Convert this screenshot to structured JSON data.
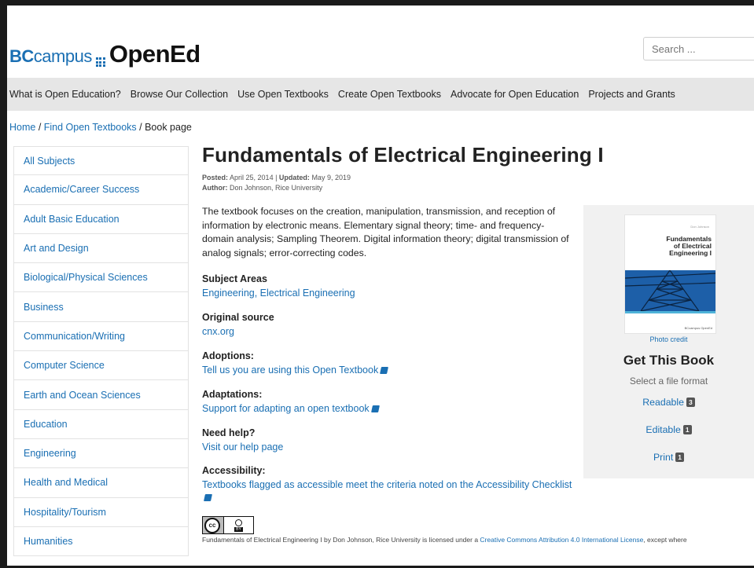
{
  "header": {
    "logo_bc": "BC",
    "logo_campus": "campus",
    "logo_opened": "OpenEd",
    "search_placeholder": "Search ..."
  },
  "nav": {
    "items": [
      "What is Open Education?",
      "Browse Our Collection",
      "Use Open Textbooks",
      "Create Open Textbooks",
      "Advocate for Open Education",
      "Projects and Grants"
    ]
  },
  "breadcrumb": {
    "home": "Home",
    "sep1": " / ",
    "find": "Find Open Textbooks",
    "sep2": " / ",
    "current": "Book page"
  },
  "sidebar": {
    "items": [
      "All Subjects",
      "Academic/Career Success",
      "Adult Basic Education",
      "Art and Design",
      "Biological/Physical Sciences",
      "Business",
      "Communication/Writing",
      "Computer Science",
      "Earth and Ocean Sciences",
      "Education",
      "Engineering",
      "Health and Medical",
      "Hospitality/Tourism",
      "Humanities"
    ]
  },
  "book": {
    "title": "Fundamentals of Electrical Engineering I",
    "posted_label": "Posted:",
    "posted": "April 25, 2014",
    "meta_sep": " | ",
    "updated_label": "Updated:",
    "updated": "May 9, 2019",
    "author_label": "Author:",
    "author": "Don Johnson, Rice University",
    "description": "The textbook focuses on the creation, manipulation, transmission, and reception of information by electronic means. Elementary signal theory; time- and frequency-domain analysis; Sampling Theorem. Digital information theory; digital transmission of analog signals; error-correcting codes."
  },
  "sections": {
    "subject_areas": {
      "heading": "Subject Areas",
      "value": "Engineering, Electrical Engineering"
    },
    "original_source": {
      "heading": "Original source",
      "value": "cnx.org"
    },
    "adoptions": {
      "heading": "Adoptions:",
      "value": "Tell us you are using this Open Textbook"
    },
    "adaptations": {
      "heading": "Adaptations:",
      "value": "Support for adapting an open textbook"
    },
    "need_help": {
      "heading": "Need help?",
      "value": "Visit our help page"
    },
    "accessibility": {
      "heading": "Accessibility:",
      "value": "Textbooks flagged as accessible meet the criteria noted on the Accessibility Checklist"
    }
  },
  "license": {
    "badge_cc": "cc",
    "badge_by": "BY",
    "text_before": "Fundamentals of Electrical Engineering I by Don Johnson, Rice University is licensed under a ",
    "link": "Creative Commons Attribution 4.0 International License",
    "text_after": ", except where"
  },
  "panel": {
    "cover_author": "Don Johnson",
    "cover_title": "Fundamentals\nof Electrical\nEngineering I",
    "cover_footer": "BCcampus OpenEd",
    "photo_credit": "Photo credit",
    "get_book": "Get This Book",
    "select_format": "Select a file format",
    "formats": [
      {
        "label": "Readable",
        "count": "3"
      },
      {
        "label": "Editable",
        "count": "1"
      },
      {
        "label": "Print",
        "count": "1"
      }
    ]
  },
  "colors": {
    "link": "#1a6fb3",
    "nav_bg": "#e6e6e6",
    "panel_bg": "#f1f1f1",
    "badge": "#555555"
  }
}
